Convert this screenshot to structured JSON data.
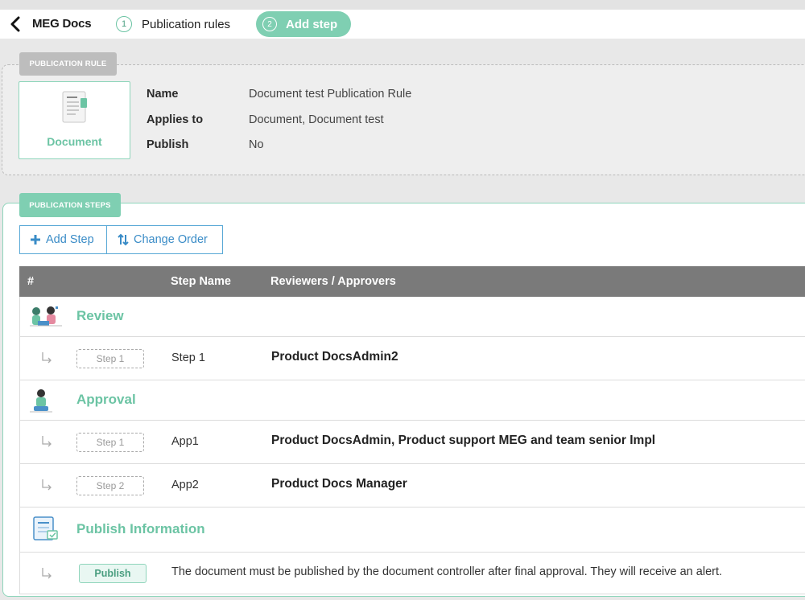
{
  "header": {
    "app_title": "MEG Docs",
    "steps": [
      {
        "num": "1",
        "label": "Publication rules"
      },
      {
        "num": "2",
        "label": "Add step"
      }
    ]
  },
  "publication_rule": {
    "tag": "PUBLICATION RULE",
    "card_label": "Document",
    "fields": [
      {
        "key": "Name",
        "value": "Document test Publication Rule"
      },
      {
        "key": "Applies to",
        "value": "Document, Document test"
      },
      {
        "key": "Publish",
        "value": "No"
      }
    ]
  },
  "publication_steps": {
    "tag": "PUBLICATION STEPS",
    "add_step_label": "Add Step",
    "change_order_label": "Change Order",
    "columns": {
      "num": "#",
      "step_name": "Step Name",
      "reviewers": "Reviewers / Approvers"
    },
    "groups": {
      "review": {
        "title": "Review",
        "rows": [
          {
            "badge": "Step 1",
            "name": "Step 1",
            "reviewers": "Product DocsAdmin2"
          }
        ]
      },
      "approval": {
        "title": "Approval",
        "rows": [
          {
            "badge": "Step 1",
            "name": "App1",
            "reviewers": "Product DocsAdmin, Product support MEG and team senior Impl"
          },
          {
            "badge": "Step 2",
            "name": "App2",
            "reviewers": "Product Docs Manager"
          }
        ]
      },
      "publish": {
        "title": "Publish Information",
        "badge": "Publish",
        "text": "The document must be published by the document controller after final approval. They will receive an alert."
      }
    }
  },
  "colors": {
    "accent": "#7fcfb2",
    "accent_text": "#6cc4a4",
    "link_blue": "#3a8cc7",
    "header_gray": "#7a7a7a"
  },
  "icons": [
    "chevron-left-icon",
    "document-icon",
    "plus-icon",
    "sort-icon",
    "review-icon",
    "approval-icon",
    "publish-info-icon",
    "subitem-arrow-icon"
  ]
}
